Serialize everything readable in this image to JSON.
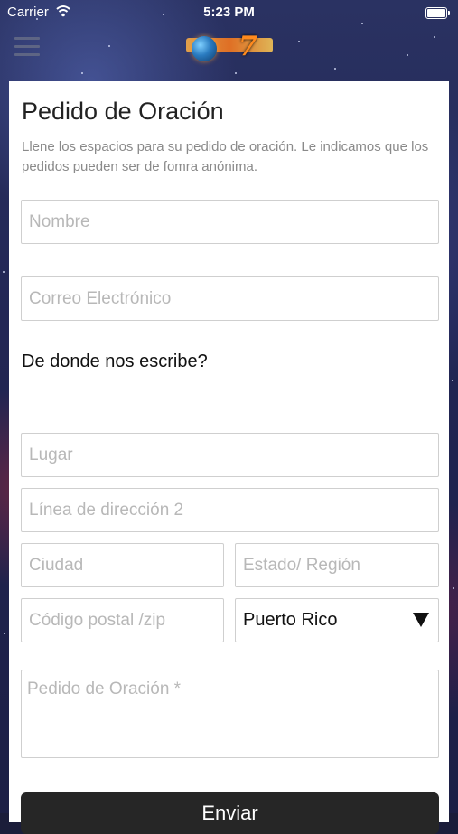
{
  "status_bar": {
    "carrier": "Carrier",
    "time": "5:23 PM"
  },
  "header": {
    "logo_text": "7"
  },
  "form": {
    "title": "Pedido de Oración",
    "intro": "Llene los espacios para su pedido de oración. Le indicamos que los pedidos pueden ser de fomra anónima.",
    "name_placeholder": "Nombre",
    "email_placeholder": "Correo Electrónico",
    "location_heading": "De donde nos escribe?",
    "place_placeholder": "Lugar",
    "address2_placeholder": "Línea de dirección 2",
    "city_placeholder": "Ciudad",
    "state_placeholder": "Estado/ Región",
    "zip_placeholder": "Código postal /zip",
    "country_selected": "Puerto Rico",
    "request_placeholder": "Pedido de Oración *",
    "submit_label": "Enviar"
  }
}
